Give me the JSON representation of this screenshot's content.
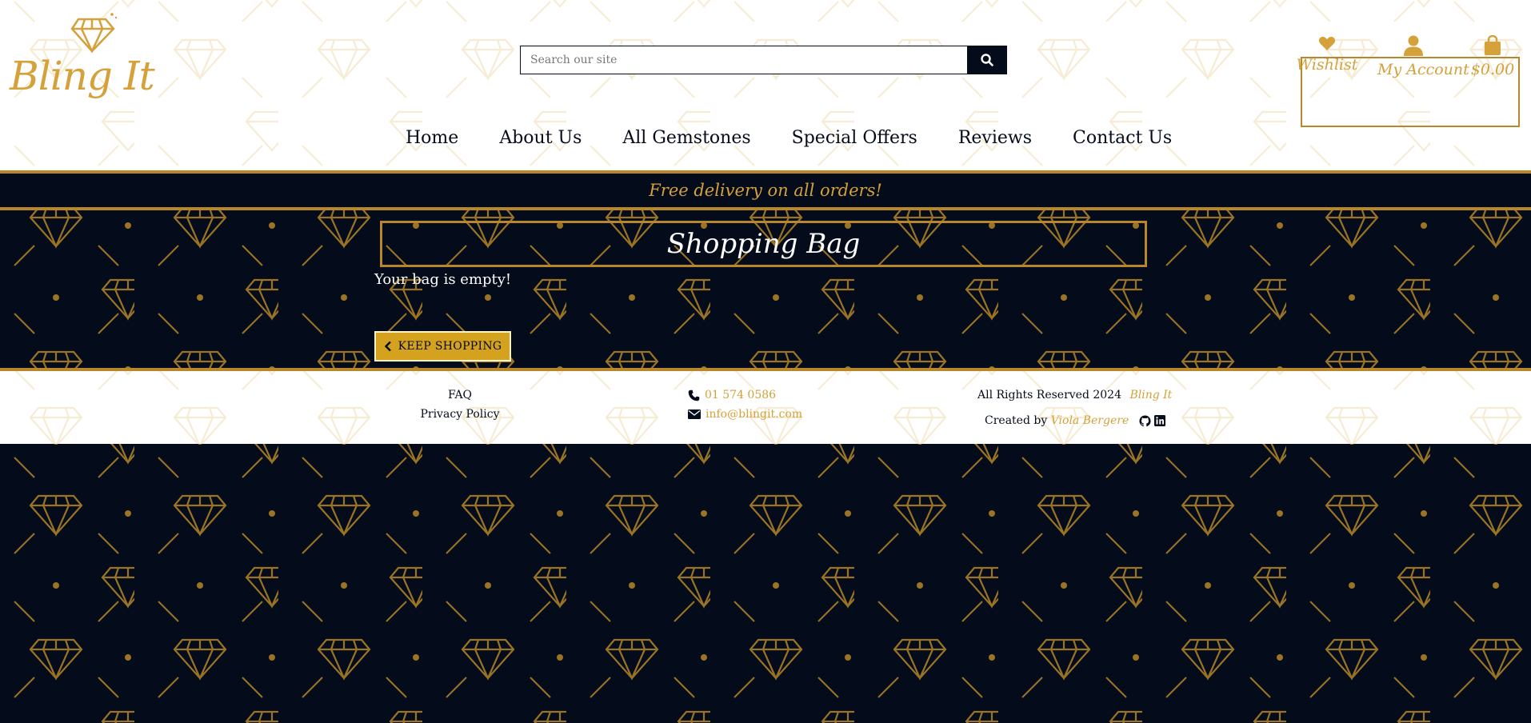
{
  "brand": {
    "name": "Bling It"
  },
  "search": {
    "placeholder": "Search our site"
  },
  "account": {
    "wishlist_label": "Wishlist",
    "my_account_label": "My Account",
    "bag_total": "$0.00"
  },
  "nav": {
    "items": [
      {
        "label": "Home"
      },
      {
        "label": "About Us"
      },
      {
        "label": "All Gemstones"
      },
      {
        "label": "Special Offers"
      },
      {
        "label": "Reviews"
      },
      {
        "label": "Contact Us"
      }
    ]
  },
  "banner": {
    "text": "Free delivery on all orders!"
  },
  "bag": {
    "title": "Shopping Bag",
    "empty_message": "Your bag is empty!",
    "keep_shopping_label": "KEEP SHOPPING"
  },
  "footer": {
    "faq_label": "FAQ",
    "privacy_label": "Privacy Policy",
    "phone": "01 574 0586",
    "email": "info@blingit.com",
    "rights_text": "All Rights Reserved 2024",
    "rights_brand": "Bling It",
    "created_by_text": "Created by",
    "creator_name": "Viola Bergere"
  },
  "colors": {
    "navy": "#040b1a",
    "gold": "#d4a13a",
    "gold_dark": "#b8862b",
    "button_gold": "#d4a21e"
  },
  "icons": [
    "diamond-icon",
    "search-icon",
    "heart-icon",
    "user-icon",
    "shopping-bag-icon",
    "chevron-left-icon",
    "phone-icon",
    "envelope-icon",
    "github-icon",
    "linkedin-icon"
  ]
}
